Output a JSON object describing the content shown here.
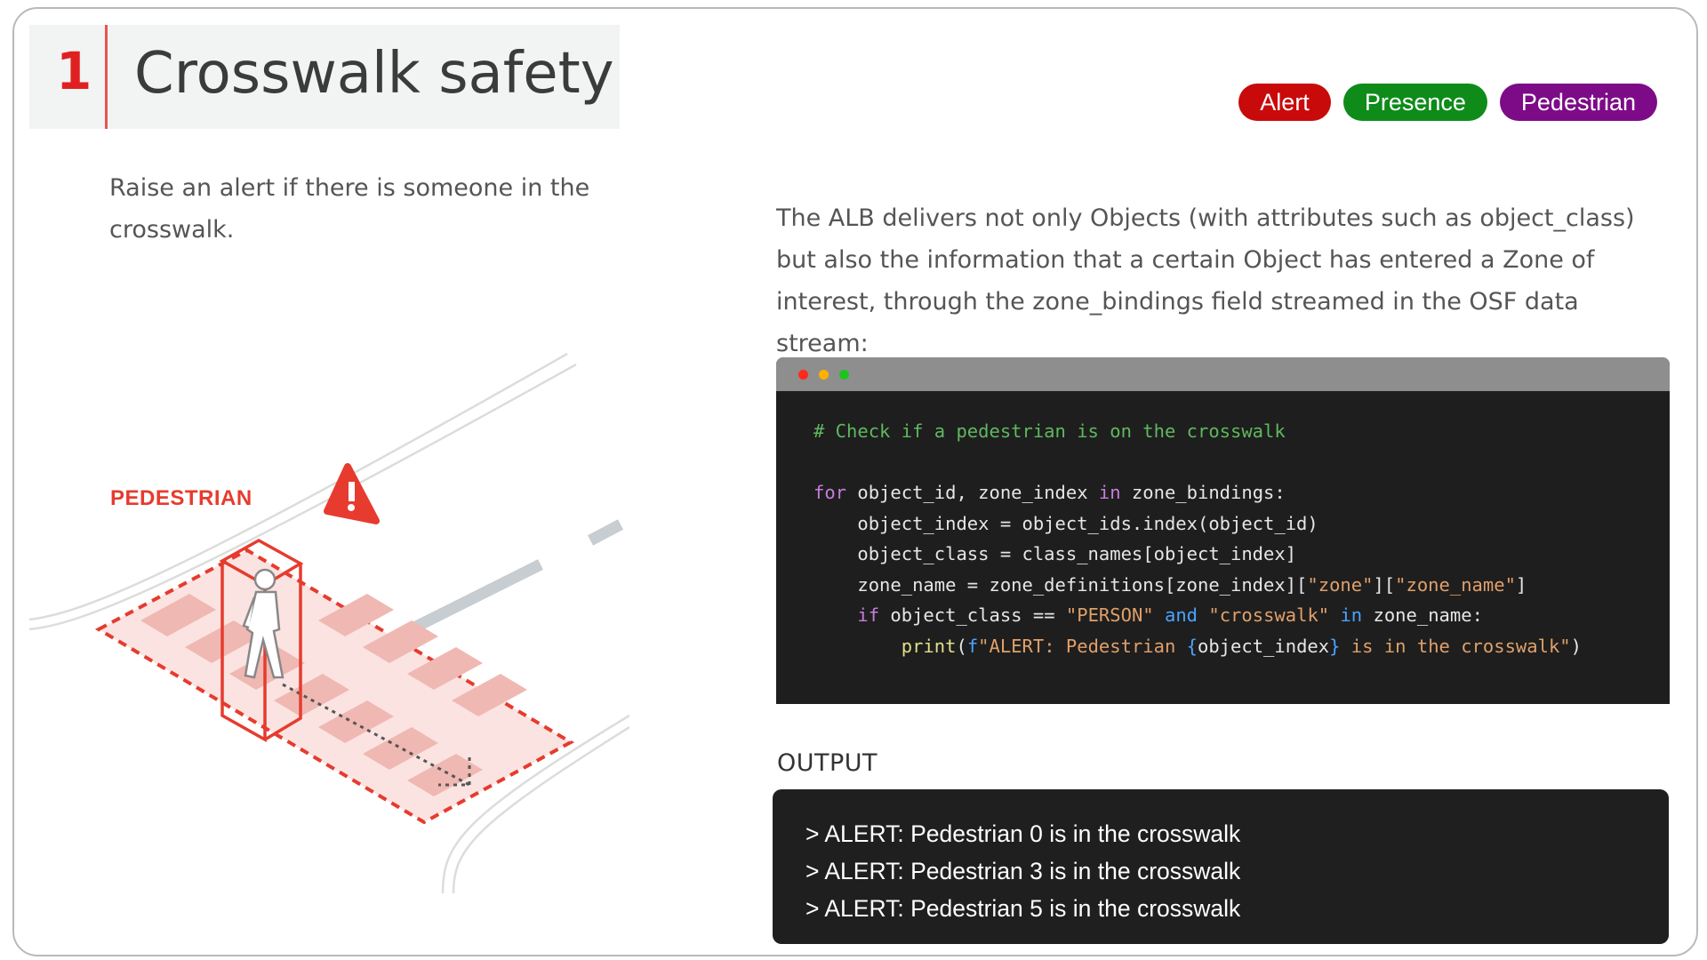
{
  "title": {
    "number": "1",
    "text": "Crosswalk safety"
  },
  "tags": [
    {
      "label": "Alert",
      "color": "#c90a0a"
    },
    {
      "label": "Presence",
      "color": "#0f8b1a"
    },
    {
      "label": "Pedestrian",
      "color": "#7d0b88"
    }
  ],
  "description": "Raise an alert if there is someone in the crosswalk.",
  "explanation": "The ALB delivers not only Objects (with attributes such as object_class) but also the information that a certain Object has entered a Zone of interest, through the zone_bindings field streamed in the OSF data stream:",
  "illustration": {
    "label": "PEDESTRIAN",
    "icons": [
      "warning-icon",
      "pedestrian-icon"
    ],
    "accent_color": "#e63b2e"
  },
  "code": {
    "window_controls": [
      "close-dot",
      "minimize-dot",
      "maximize-dot"
    ],
    "comment": "# Check if a pedestrian is on the crosswalk",
    "line1": {
      "kw_for": "for",
      "vars": " object_id, zone_index ",
      "kw_in": "in",
      "rest": " zone_bindings:"
    },
    "line2": "    object_index = object_ids.index(object_id)",
    "line3": "    object_class = class_names[object_index]",
    "line4": {
      "pre": "    zone_name = zone_definitions[zone_index][",
      "s1": "\"zone\"",
      "mid": "][",
      "s2": "\"zone_name\"",
      "post": "]"
    },
    "line5": {
      "indent": "    ",
      "kw_if": "if",
      "a": " object_class == ",
      "s1": "\"PERSON\"",
      "sp1": " ",
      "kw_and": "and",
      "sp2": " ",
      "s2": "\"crosswalk\"",
      "sp3": " ",
      "kw_in": "in",
      "b": " zone_name:"
    },
    "line6": {
      "indent": "        ",
      "fn": "print",
      "p1": "(",
      "f": "f",
      "s1": "\"ALERT: Pedestrian ",
      "b1": "{",
      "var": "object_index",
      "b2": "}",
      "s2": " is in the crosswalk\"",
      "p2": ")"
    }
  },
  "output": {
    "label": "OUTPUT",
    "lines": [
      "> ALERT: Pedestrian 0 is in the crosswalk",
      "> ALERT: Pedestrian 3 is in the crosswalk",
      "> ALERT: Pedestrian 5 is in the crosswalk"
    ]
  }
}
